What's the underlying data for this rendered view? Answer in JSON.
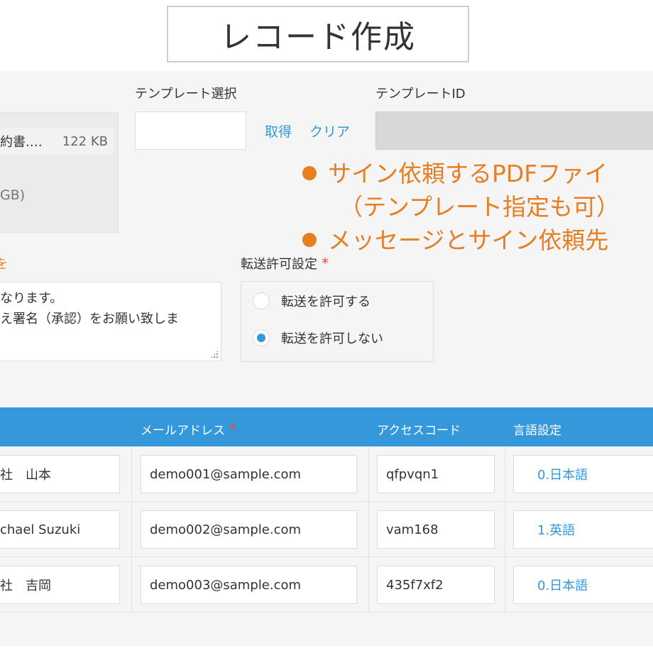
{
  "title": "レコード作成",
  "attachment": {
    "file_name": "約書.…",
    "file_size": "122 KB",
    "total": "GB)"
  },
  "template": {
    "label": "テンプレート選択",
    "value": "",
    "fetch_label": "取得",
    "clear_label": "クリア",
    "id_label": "テンプレートID"
  },
  "notes": [
    "サイン依頼するPDFファイ",
    "（テンプレート指定も可）",
    "メッセージとサイン依頼先"
  ],
  "message": {
    "label_fragment": "を",
    "lines": [
      "なります。",
      "え署名（承認）をお願い致しま",
      ""
    ]
  },
  "transfer": {
    "label": "転送許可設定",
    "required_mark": "*",
    "options": [
      {
        "label": "転送を許可する",
        "selected": false
      },
      {
        "label": "転送を許可しない",
        "selected": true
      }
    ]
  },
  "table": {
    "headers": {
      "email": "メールアドレス",
      "email_required": "*",
      "access_code": "アクセスコード",
      "language": "言語設定"
    },
    "rows": [
      {
        "name": "社　山本",
        "email": "demo001@sample.com",
        "code": "qfpvqn1",
        "lang": "0.日本語"
      },
      {
        "name": "chael Suzuki",
        "email": "demo002@sample.com",
        "code": "vam168",
        "lang": "1.英語"
      },
      {
        "name": "社　吉岡",
        "email": "demo003@sample.com",
        "code": "435f7xf2",
        "lang": "0.日本語"
      }
    ]
  },
  "colors": {
    "accent": "#3498db",
    "note": "#e67e22",
    "required": "#e74c3c"
  }
}
